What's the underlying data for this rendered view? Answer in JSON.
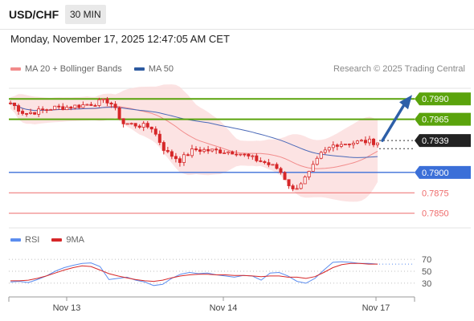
{
  "header": {
    "symbol": "USD/CHF",
    "timeframe": "30 MIN"
  },
  "datetime": "Monday, November 17, 2025 12:47:05 AM CET",
  "legend": {
    "ma20_bb": "MA 20 + Bollinger Bands",
    "ma50": "MA 50",
    "rsi": "RSI",
    "ma9": "9MA"
  },
  "credit": "Research © 2025 Trading Central",
  "colors": {
    "candle": "#d62728",
    "bollinger_fill": "#fbdada",
    "ma20": "#f28b8b",
    "ma50": "#4a69b8",
    "resistance": "#5aa30c",
    "support_blue": "#3b6fd8",
    "support_red": "#ee6b6b",
    "arrow": "#2d5fa8",
    "price_box": "#222222",
    "rsi": "#5b8def",
    "rsi_ma": "#d62728"
  },
  "chart_data": {
    "type": "candlestick",
    "symbol": "USD/CHF",
    "timeframe": "30 MIN",
    "x_ticks": [
      "Nov 13",
      "Nov 14",
      "Nov 17"
    ],
    "y_range": [
      0.7836,
      0.8001
    ],
    "levels": [
      {
        "label": "0.7990",
        "value": 0.799,
        "kind": "resistance"
      },
      {
        "label": "0.7965",
        "value": 0.7965,
        "kind": "resistance"
      },
      {
        "label": "0.7939",
        "value": 0.7939,
        "kind": "last_price"
      },
      {
        "label": "0.7900",
        "value": 0.79,
        "kind": "support"
      },
      {
        "label": "0.7875",
        "value": 0.7875,
        "kind": "support"
      },
      {
        "label": "0.7850",
        "value": 0.785,
        "kind": "support"
      }
    ],
    "price_path": [
      0.7985,
      0.7972,
      0.7975,
      0.7979,
      0.798,
      0.7982,
      0.7985,
      0.7988,
      0.796,
      0.7958,
      0.7955,
      0.7925,
      0.7915,
      0.7928,
      0.7927,
      0.7926,
      0.7925,
      0.7918,
      0.7912,
      0.7904,
      0.7878,
      0.7895,
      0.7922,
      0.7935,
      0.7936,
      0.7938,
      0.7937
    ],
    "rsi": {
      "ticks": [
        70,
        50,
        30
      ],
      "range": [
        15,
        85
      ],
      "values": [
        32,
        33,
        31,
        36,
        42,
        50,
        56,
        60,
        63,
        64,
        58,
        36,
        38,
        40,
        35,
        32,
        26,
        28,
        38,
        45,
        48,
        46,
        47,
        44,
        42,
        40,
        43,
        42,
        35,
        47,
        48,
        42,
        33,
        30,
        38,
        52,
        65,
        66,
        65,
        63,
        63,
        62
      ],
      "ma9": [
        34,
        34,
        35,
        38,
        42,
        47,
        52,
        56,
        59,
        58,
        52,
        46,
        42,
        39,
        36,
        34,
        33,
        35,
        39,
        42,
        44,
        45,
        45,
        44,
        44,
        43,
        43,
        42,
        41,
        42,
        42,
        40,
        40,
        38,
        41,
        48,
        56,
        61,
        63,
        63,
        62,
        62
      ]
    }
  }
}
